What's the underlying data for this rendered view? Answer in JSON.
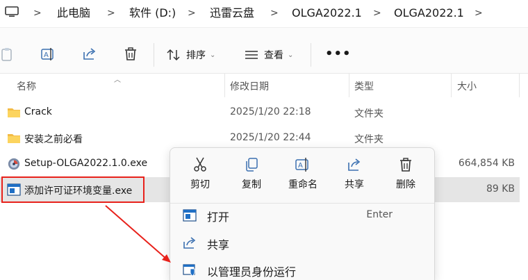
{
  "breadcrumb": {
    "items": [
      "此电脑",
      "软件 (D:)",
      "迅雷云盘",
      "OLGA2022.1",
      "OLGA2022.1"
    ],
    "separator": ">"
  },
  "toolbar": {
    "sort_label": "排序",
    "view_label": "查看",
    "more_label": "•••"
  },
  "columns": {
    "name": "名称",
    "date": "修改日期",
    "type": "类型",
    "size": "大小"
  },
  "files": [
    {
      "name": "Crack",
      "date": "2025/1/20 22:18",
      "type": "文件夹",
      "size": "",
      "icon": "folder-icon"
    },
    {
      "name": "安装之前必看",
      "date": "2025/1/20 22:44",
      "type": "文件夹",
      "size": "",
      "icon": "folder-icon"
    },
    {
      "name": "Setup-OLGA2022.1.0.exe",
      "date": "",
      "type": "",
      "size": "664,854 KB",
      "icon": "installer-icon"
    },
    {
      "name": "添加许可证环境变量.exe",
      "date": "",
      "type": "",
      "size": "89 KB",
      "icon": "exe-window-icon"
    }
  ],
  "context_menu": {
    "quick_actions": [
      {
        "label": "剪切",
        "icon": "scissors-icon"
      },
      {
        "label": "复制",
        "icon": "copy-icon"
      },
      {
        "label": "重命名",
        "icon": "rename-icon"
      },
      {
        "label": "共享",
        "icon": "share-icon"
      },
      {
        "label": "删除",
        "icon": "trash-icon"
      }
    ],
    "items": [
      {
        "label": "打开",
        "shortcut": "Enter",
        "icon": "open-window-icon"
      },
      {
        "label": "共享",
        "shortcut": "",
        "icon": "share-icon"
      },
      {
        "label": "以管理员身份运行",
        "shortcut": "",
        "icon": "admin-shield-icon"
      }
    ]
  },
  "colors": {
    "accent": "#0067c0",
    "annotation_red": "#e8211b",
    "selection": "#e5e5e5",
    "folder": "#f3bb45"
  }
}
